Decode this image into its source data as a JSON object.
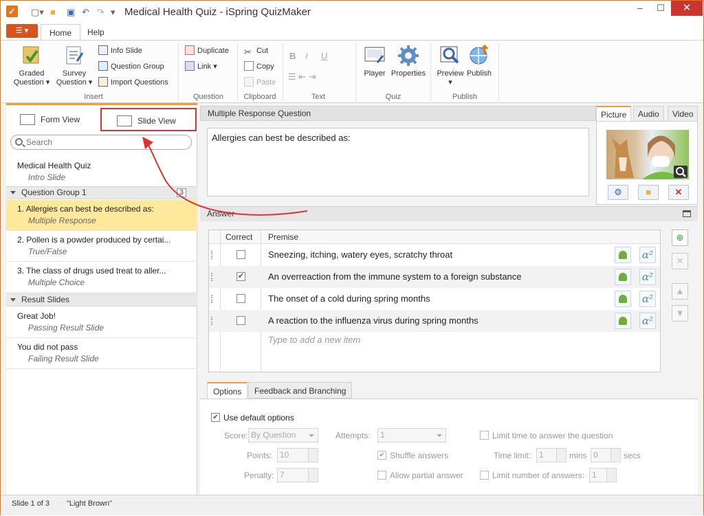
{
  "window": {
    "title": "Medical Health Quiz - iSpring QuizMaker",
    "controls": {
      "minimize": "–",
      "maximize": "☐",
      "close": "✕"
    }
  },
  "quick_access": [
    "new-icon",
    "open-icon",
    "save-icon",
    "undo-icon",
    "redo-icon",
    "customize-icon"
  ],
  "ribbon": {
    "tabs": [
      {
        "label": "Home",
        "active": true
      },
      {
        "label": "Help",
        "active": false
      }
    ],
    "groups": {
      "insert": {
        "label": "Insert",
        "graded": "Graded",
        "graded2": "Question",
        "survey": "Survey",
        "survey2": "Question",
        "info_slide": "Info Slide",
        "question_group": "Question Group",
        "import_questions": "Import Questions"
      },
      "question": {
        "label": "Question",
        "duplicate": "Duplicate",
        "link": "Link"
      },
      "clipboard": {
        "label": "Clipboard",
        "cut": "Cut",
        "copy": "Copy",
        "paste": "Paste"
      },
      "text": {
        "label": "Text",
        "bold": "B",
        "italic": "I",
        "underline": "U"
      },
      "quiz": {
        "label": "Quiz",
        "player": "Player",
        "properties": "Properties"
      },
      "publish": {
        "label": "Publish",
        "preview": "Preview",
        "publish": "Publish"
      }
    }
  },
  "left_panel": {
    "form_view": "Form View",
    "slide_view": "Slide View",
    "search_placeholder": "Search",
    "intro": {
      "title": "Medical Health Quiz",
      "subtitle": "Intro Slide"
    },
    "question_group": {
      "label": "Question Group 1",
      "count": "3"
    },
    "questions": [
      {
        "title": "1. Allergies can best be described as:",
        "subtitle": "Multiple Response",
        "selected": true
      },
      {
        "title": "2. Pollen is a powder produced by certai...",
        "subtitle": "True/False",
        "selected": false
      },
      {
        "title": "3. The class of drugs used treat to aller...",
        "subtitle": "Multiple Choice",
        "selected": false
      }
    ],
    "result_group": {
      "label": "Result Slides"
    },
    "results": [
      {
        "title": "Great Job!",
        "subtitle": "Passing Result Slide"
      },
      {
        "title": "You did not pass",
        "subtitle": "Failing Result Slide"
      }
    ]
  },
  "question": {
    "type": "Multiple Response Question",
    "text": "Allergies can best be described as:"
  },
  "media_tabs": [
    "Picture",
    "Audio",
    "Video"
  ],
  "answer": {
    "label": "Answer",
    "col_correct": "Correct",
    "col_premise": "Premise",
    "rows": [
      {
        "text": "Sneezing, itching, watery eyes, scratchy throat",
        "correct": false
      },
      {
        "text": "An overreaction from the immune system to a foreign substance",
        "correct": true
      },
      {
        "text": "The onset of a cold during spring months",
        "correct": false
      },
      {
        "text": "A reaction to the influenza virus during spring months",
        "correct": false
      }
    ],
    "add_placeholder": "Type to add a new item"
  },
  "options_tabs": [
    "Options",
    "Feedback and Branching"
  ],
  "options": {
    "use_default": "Use default options",
    "score_label": "Score:",
    "score_value": "By Question",
    "points_label": "Points:",
    "points_value": "10",
    "penalty_label": "Penalty:",
    "penalty_value": "7",
    "attempts_label": "Attempts:",
    "attempts_value": "1",
    "shuffle": "Shuffle answers",
    "partial": "Allow partial answer",
    "limit_time": "Limit time to answer the question",
    "time_limit_label": "Time limit:",
    "time_min": "1",
    "mins": "mins",
    "time_sec": "0",
    "secs": "secs",
    "limit_answers": "Limit number of answers:",
    "limit_answers_value": "1"
  },
  "status": {
    "slide": "Slide 1 of 3",
    "theme": "\"Light Brown\""
  },
  "colors": {
    "accent": "#f0a030",
    "file_menu": "#d9531e",
    "selection": "#fde89c",
    "annotation": "#e23030"
  }
}
